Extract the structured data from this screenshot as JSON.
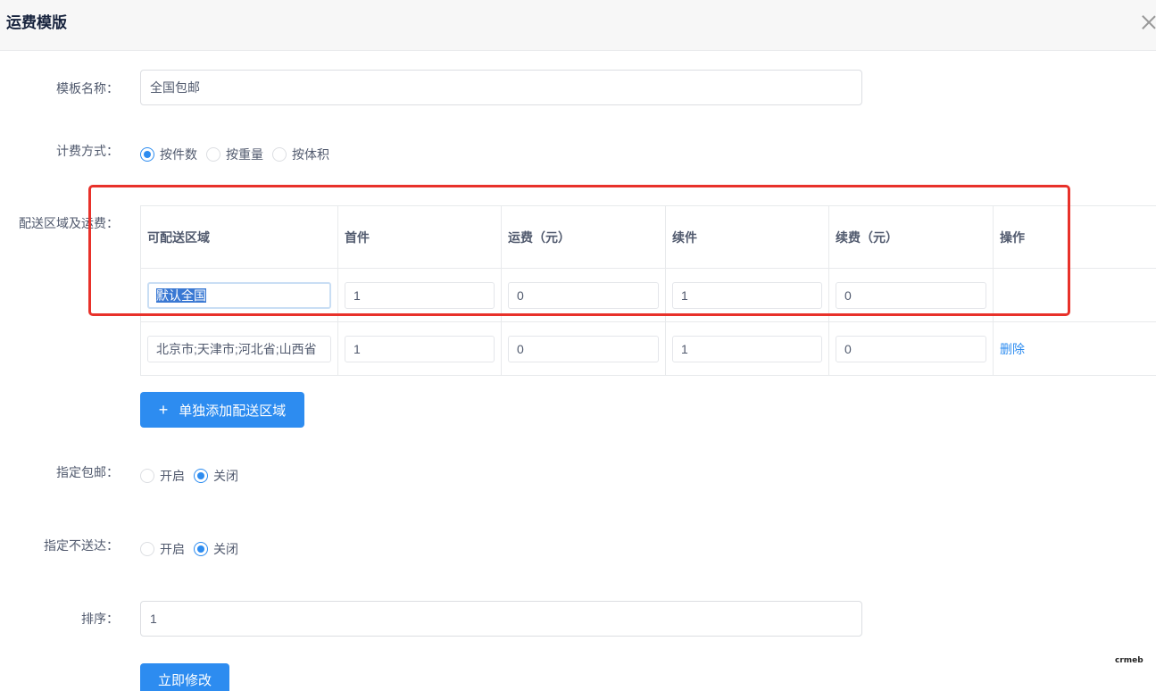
{
  "modal": {
    "title": "运费模版"
  },
  "form": {
    "template_name": {
      "label": "模板名称：",
      "value": "全国包邮"
    },
    "billing": {
      "label": "计费方式：",
      "options": [
        {
          "label": "按件数",
          "checked": true
        },
        {
          "label": "按重量",
          "checked": false
        },
        {
          "label": "按体积",
          "checked": false
        }
      ]
    },
    "region": {
      "label": "配送区域及运费：",
      "columns": [
        "可配送区域",
        "首件",
        "运费（元）",
        "续件",
        "续费（元）",
        "操作"
      ],
      "rows": [
        {
          "area": "默认全国",
          "first": "1",
          "fee": "0",
          "next": "1",
          "next_fee": "0",
          "action": ""
        },
        {
          "area": "北京市;天津市;河北省;山西省",
          "first": "1",
          "fee": "0",
          "next": "1",
          "next_fee": "0",
          "action": "删除"
        }
      ],
      "add_button": "单独添加配送区域"
    },
    "free_shipping": {
      "label": "指定包邮：",
      "options": [
        {
          "label": "开启",
          "checked": false
        },
        {
          "label": "关闭",
          "checked": true
        }
      ]
    },
    "no_delivery": {
      "label": "指定不送达：",
      "options": [
        {
          "label": "开启",
          "checked": false
        },
        {
          "label": "关闭",
          "checked": true
        }
      ]
    },
    "sort": {
      "label": "排序：",
      "value": "1"
    },
    "submit_button": "立即修改"
  },
  "watermark": "crmeb",
  "colors": {
    "primary": "#2d8cf0",
    "highlight_box": "#e8312a",
    "selection": "#3978d3"
  }
}
